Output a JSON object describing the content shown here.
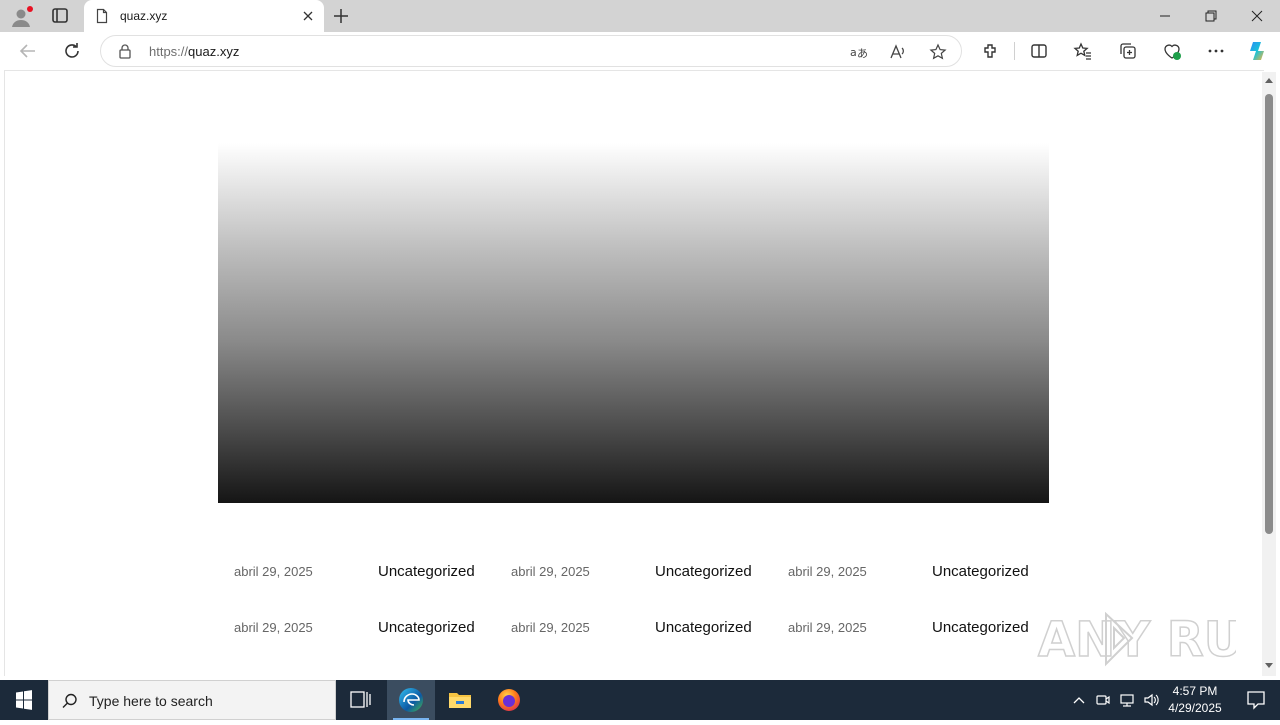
{
  "browser": {
    "tab": {
      "title": "quaz.xyz"
    },
    "address": {
      "protocol": "https://",
      "host": "quaz.xyz"
    }
  },
  "page": {
    "posts": [
      [
        {
          "date": "abril 29, 2025",
          "category": "Uncategorized"
        },
        {
          "date": "abril 29, 2025",
          "category": "Uncategorized"
        },
        {
          "date": "abril 29, 2025",
          "category": "Uncategorized"
        }
      ],
      [
        {
          "date": "abril 29, 2025",
          "category": "Uncategorized"
        },
        {
          "date": "abril 29, 2025",
          "category": "Uncategorized"
        },
        {
          "date": "abril 29, 2025",
          "category": "Uncategorized"
        }
      ]
    ]
  },
  "watermark": {
    "text": "ANY RUN"
  },
  "taskbar": {
    "search_placeholder": "Type here to search",
    "time": "4:57 PM",
    "date": "4/29/2025"
  },
  "colors": {
    "taskbar": "#1c2a3a",
    "tabstrip": "#d3d3d3",
    "edge_accent": "#0078d4"
  }
}
